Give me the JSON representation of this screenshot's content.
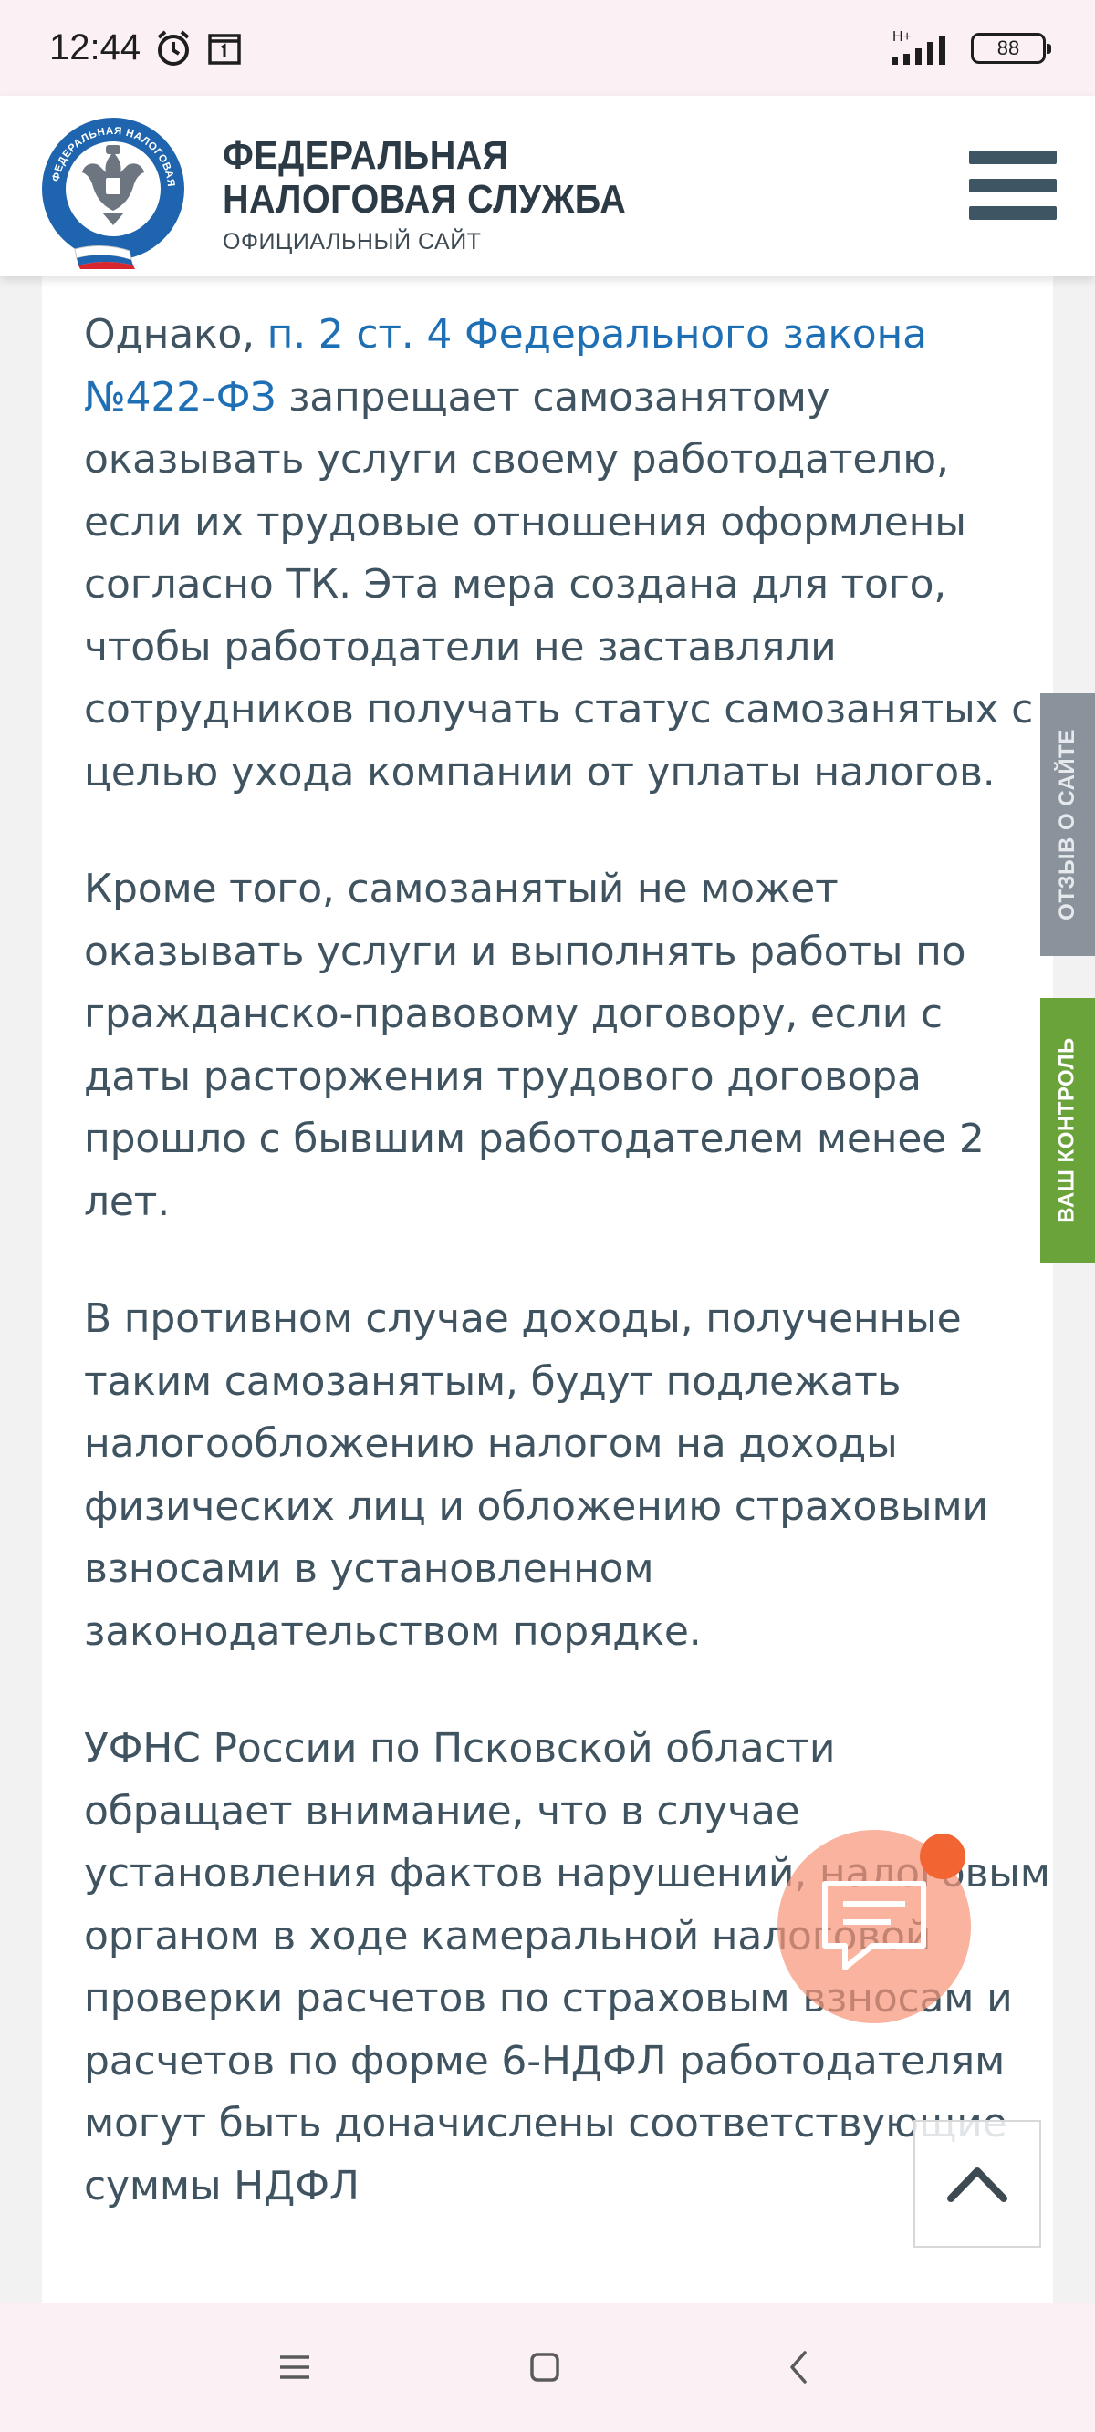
{
  "status_bar": {
    "time": "12:44",
    "network": "H+",
    "battery": "88"
  },
  "header": {
    "title_line1": "ФЕДЕРАЛЬНАЯ",
    "title_line2": "НАЛОГОВАЯ СЛУЖБА",
    "subtitle": "ОФИЦИАЛЬНЫЙ САЙТ",
    "logo_text": "ФЕДЕРАЛЬНАЯ НАЛОГОВАЯ СЛУЖБА"
  },
  "article": {
    "p1_prefix": "Однако, ",
    "p1_link": "п. 2 ст. 4 Федерального закона №422-ФЗ",
    "p1_suffix": " запрещает самозанятому оказывать услуги своему работодателю, если их трудовые отношения оформлены согласно ТК. Эта мера создана для того, чтобы работодатели не заставляли сотрудников получать статус самозанятых с целью ухода компании от уплаты налогов.",
    "p2": "Кроме того, самозанятый не может оказывать услуги и выполнять работы по гражданско-правовому договору, если с даты расторжения трудового договора прошло с бывшим работодателем менее 2 лет.",
    "p3": "В противном случае доходы, полученные таким самозанятым, будут подлежать налогообложению налогом на доходы физических лиц и обложению страховыми взносами в установленном законодательством порядке.",
    "p4": "УФНС России по Псковской области обращает внимание, что в случае установления фактов нарушений, налоговым органом в ходе камеральной налоговой проверки расчетов по страховым взносам и расчетов по форме 6-НДФЛ работодателям могут быть доначислены соответствующие суммы НДФЛ"
  },
  "side_tabs": {
    "feedback": "ОТЗЫВ О САЙТЕ",
    "control": "ВАШ КОНТРОЛЬ"
  },
  "colors": {
    "link": "#1f6fb5",
    "text": "#3f5460",
    "feedback_tab": "#8a939c",
    "control_tab": "#6aa339",
    "chat_badge": "#f26532"
  },
  "icons": {
    "menu": "hamburger-icon",
    "chat": "chat-bubble-icon",
    "scroll_top": "chevron-up-icon",
    "nav_recents": "menu-lines-icon",
    "nav_home": "square-icon",
    "nav_back": "back-chevron-icon"
  }
}
